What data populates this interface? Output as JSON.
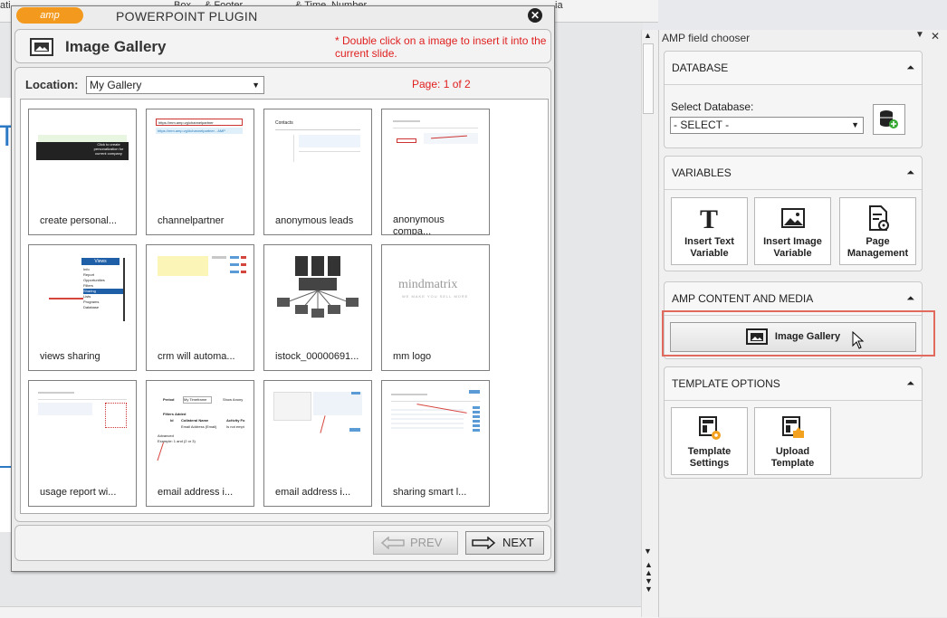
{
  "ribbon": {
    "fragment_left": "ati",
    "fragment_1": "Box",
    "fragment_2": "& Footer",
    "fragment_3": "& Time",
    "fragment_4": "Number",
    "fragment_right": "ia"
  },
  "dialog": {
    "logo_text": "amp",
    "title": "POWERPOINT PLUGIN",
    "close_glyph": "✕",
    "header_title": "Image Gallery",
    "header_note": "* Double click on a image to insert it into the current slide.",
    "location_label": "Location:",
    "location_value": "My Gallery",
    "page_indicator": "Page: 1 of 2",
    "images": [
      {
        "caption": "create personal..."
      },
      {
        "caption": "channelpartner"
      },
      {
        "caption": "anonymous leads"
      },
      {
        "caption": "anonymous compa..."
      },
      {
        "caption": "views sharing"
      },
      {
        "caption": "crm will automa..."
      },
      {
        "caption": "istock_00000691..."
      },
      {
        "caption": "mm logo"
      },
      {
        "caption": "usage report wi..."
      },
      {
        "caption": "email address i..."
      },
      {
        "caption": "email address i..."
      },
      {
        "caption": "sharing smart l..."
      }
    ],
    "prev_label": "PREV",
    "next_label": "NEXT",
    "thumb_text": {
      "t1_banner": "Click to create personalization for current company",
      "t2_url": "https://mm.amp.vg/channelpartner",
      "t2_url2": "https://mm.amp.vg/#channelpartner - AMP",
      "t3_title": "Contacts",
      "t5_menu_title": "Views",
      "t5_items": [
        "Info",
        "Report",
        "Opportunities",
        "Filters",
        "Sharing",
        "Lists",
        "Programs",
        "Database"
      ],
      "t8_logo": "mindmatrix",
      "t8_tagline": "WE MAKE YOU SELL MORE",
      "t10_title": "Period",
      "t10_value": "My Timeframe",
      "t10_check": "Show Anony",
      "t10_filters": "Filters Added",
      "t10_col1": "Id",
      "t10_col2": "Collateral Name",
      "t10_col3": "Activity Fo",
      "t10_row": "Email Address (Email)",
      "t10_row2": "Is not empt",
      "t10_adv": "Advanced",
      "t10_adv2": "Example: 1 and (2 or 3)"
    }
  },
  "pane": {
    "title": "AMP field chooser",
    "dropdown_glyph": "▼",
    "close_glyph": "✕",
    "chevron_glyph": "⏶",
    "database": {
      "header": "DATABASE",
      "select_label": "Select Database:",
      "select_value": "- SELECT -"
    },
    "variables": {
      "header": "VARIABLES",
      "tiles": [
        {
          "label": "Insert Text Variable"
        },
        {
          "label": "Insert Image Variable"
        },
        {
          "label": "Page Management"
        }
      ]
    },
    "content_media": {
      "header": "AMP CONTENT AND MEDIA",
      "button_label": "Image Gallery"
    },
    "template_options": {
      "header": "TEMPLATE OPTIONS",
      "tiles": [
        {
          "label": "Template Settings"
        },
        {
          "label": "Upload Template"
        }
      ]
    }
  }
}
